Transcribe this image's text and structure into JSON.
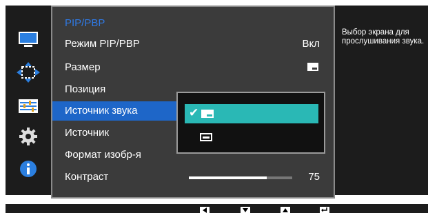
{
  "menu": {
    "title": "PIP/PBP",
    "items": [
      {
        "label": "Режим PIP/PBP",
        "value": "Вкл"
      },
      {
        "label": "Размер",
        "value_icon": "pip-size-icon"
      },
      {
        "label": "Позиция"
      },
      {
        "label": "Источник звука",
        "selected": true
      },
      {
        "label": "Источник"
      },
      {
        "label": "Формат изобр-я"
      },
      {
        "label": "Контраст",
        "value": "75",
        "slider_percent": 75
      }
    ]
  },
  "dropdown": {
    "options": [
      {
        "icon": "pip-main-sound-icon",
        "selected": true
      },
      {
        "icon": "pip-sub-sound-icon",
        "selected": false
      }
    ]
  },
  "help": {
    "text": "Выбор экрана для прослушивания звука."
  },
  "nav_icons": [
    "monitor-icon",
    "move-arrows-icon",
    "adjust-bars-icon",
    "gear-icon",
    "info-icon"
  ],
  "bottom_buttons": [
    "left-arrow-icon",
    "down-arrow-icon",
    "up-arrow-icon",
    "enter-icon"
  ],
  "colors": {
    "title_blue": "#2f7ae6",
    "selection_blue": "#1e66c8",
    "dropdown_teal": "#2ab8b5"
  }
}
